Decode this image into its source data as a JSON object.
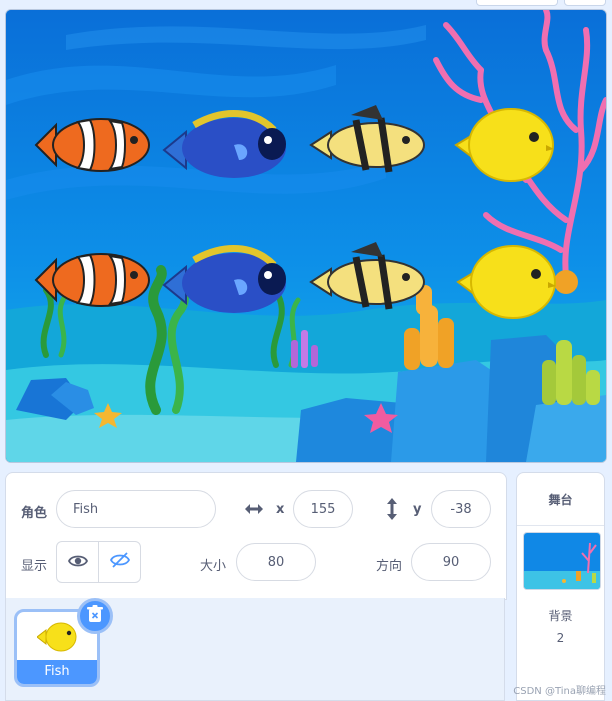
{
  "sprite_info": {
    "sprite_label": "角色",
    "sprite_name": "Fish",
    "x_label": "x",
    "x_value": "155",
    "y_label": "y",
    "y_value": "-38",
    "show_label": "显示",
    "size_label": "大小",
    "size_value": "80",
    "direction_label": "方向",
    "direction_value": "90"
  },
  "sprite_list": [
    {
      "name": "Fish",
      "selected": true
    }
  ],
  "stage_panel": {
    "title": "舞台",
    "backdrop_label": "背景",
    "backdrop_count": "2"
  },
  "watermark": "CSDN @Tina聊编程",
  "icons": {
    "x_arrows": "double-arrow-horizontal-icon",
    "y_arrows": "double-arrow-vertical-icon",
    "show": "eye-icon",
    "hide": "eye-slash-icon",
    "delete": "trash-icon"
  },
  "colors": {
    "accent": "#4c97ff",
    "text": "#575e75",
    "panel_bg": "#e9f1fc"
  }
}
